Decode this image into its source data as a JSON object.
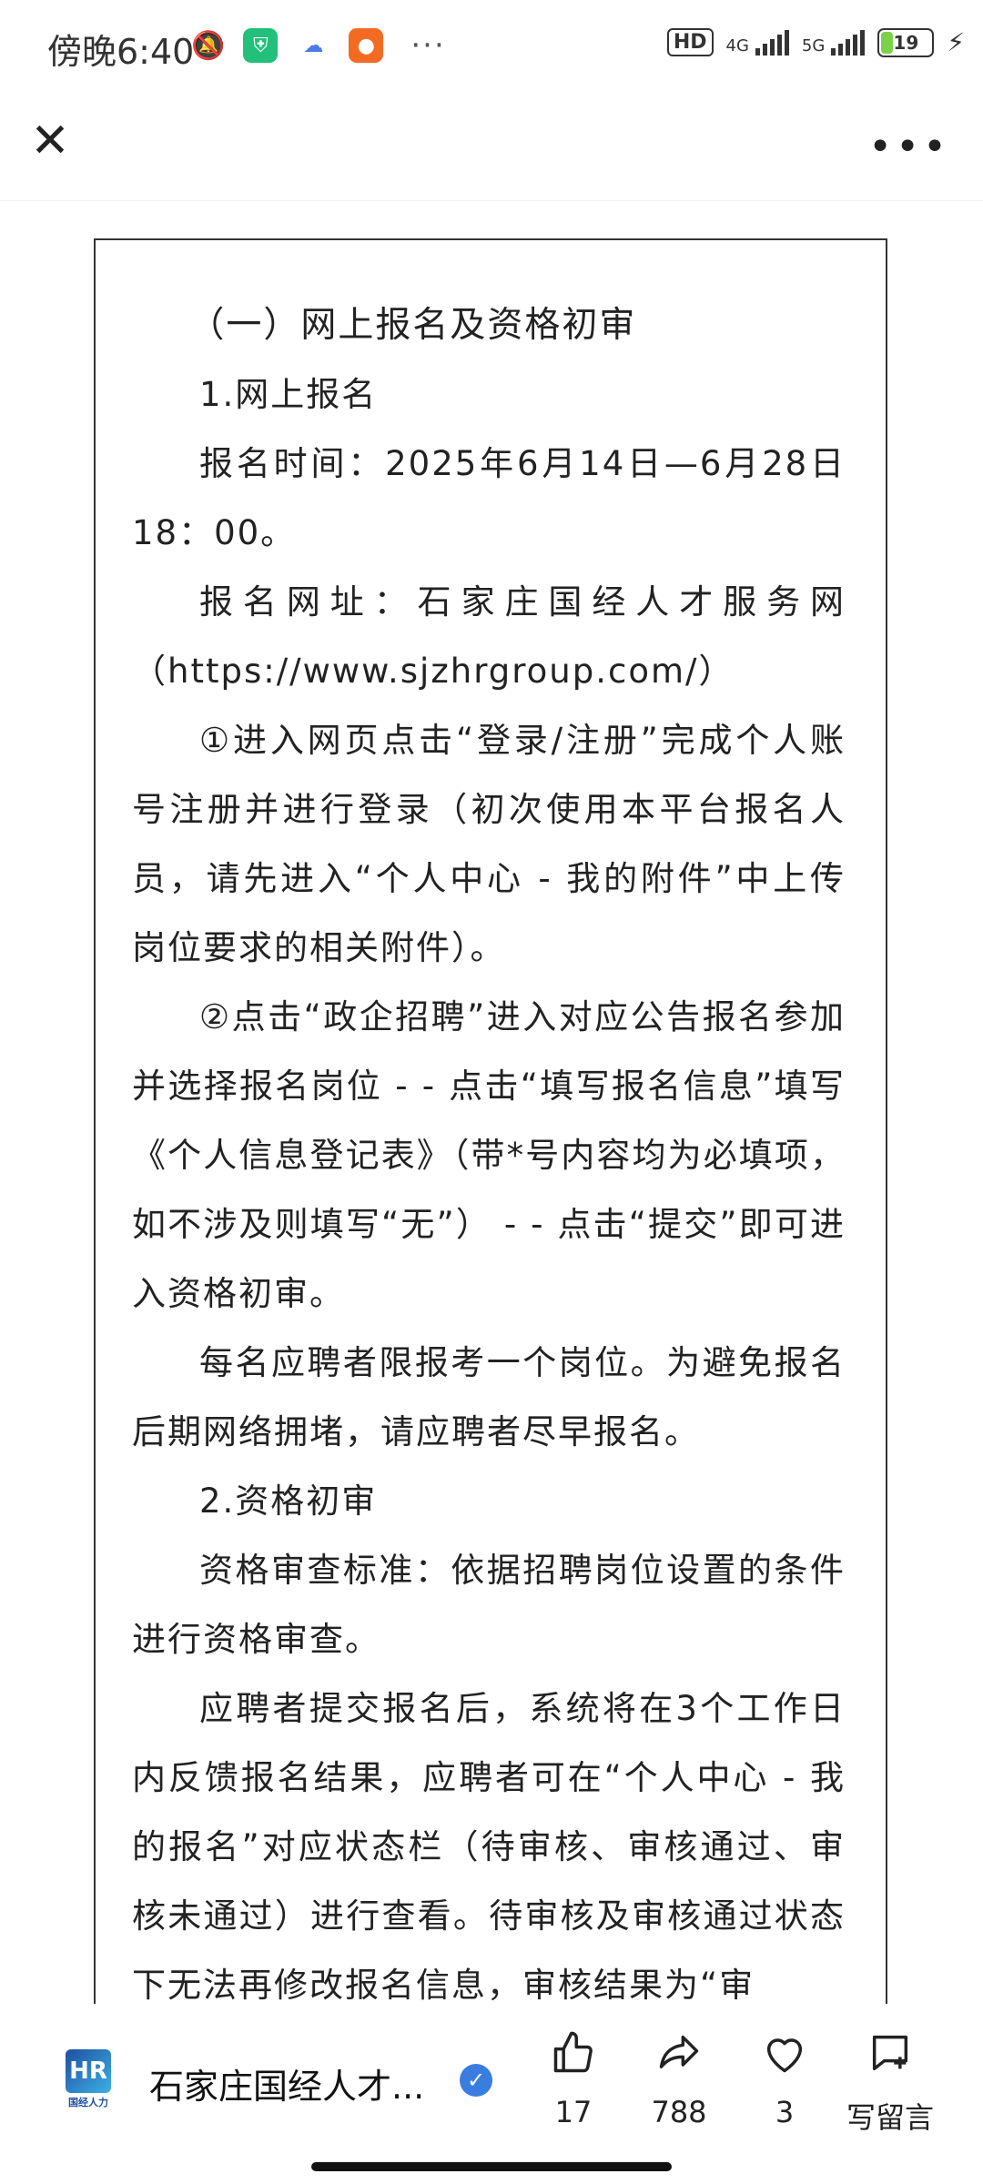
{
  "status_bar": {
    "time": "傍晚6:40",
    "hd_label": "HD",
    "net1": "4G",
    "net2": "5G",
    "battery": "19"
  },
  "article": {
    "paragraphs": [
      "（一）网上报名及资格初审",
      "1.网上报名",
      "报名时间：2025年6月14日—6月28日18：00。",
      "报名网址：石家庄国经人才服务网（https://www.sjzhrgroup.com/）",
      "①进入网页点击“登录/注册”完成个人账号注册并进行登录（初次使用本平台报名人员，请先进入“个人中心 - 我的附件”中上传岗位要求的相关附件）。",
      "②点击“政企招聘”进入对应公告报名参加并选择报名岗位 - - 点击“填写报名信息”填写《个人信息登记表》（带*号内容均为必填项，如不涉及则填写“无”） - - 点击“提交”即可进入资格初审。",
      "每名应聘者限报考一个岗位。为避免报名后期网络拥堵，请应聘者尽早报名。",
      "2.资格初审",
      "资格审查标准：依据招聘岗位设置的条件进行资格审查。",
      "应聘者提交报名后，系统将在3个工作日内反馈报名结果，应聘者可在“个人中心 - 我的报名”对应状态栏（待审核、审核通过、审核未通过）进行查看。待审核及审核通过状态下无法再修改报名信息，审核结果为“审"
    ]
  },
  "bottom_bar": {
    "logo_caption": "国经人力",
    "account_name": "石家庄国经人才...",
    "like_count": "17",
    "share_count": "788",
    "favorite_count": "3",
    "comment_label": "写留言"
  }
}
